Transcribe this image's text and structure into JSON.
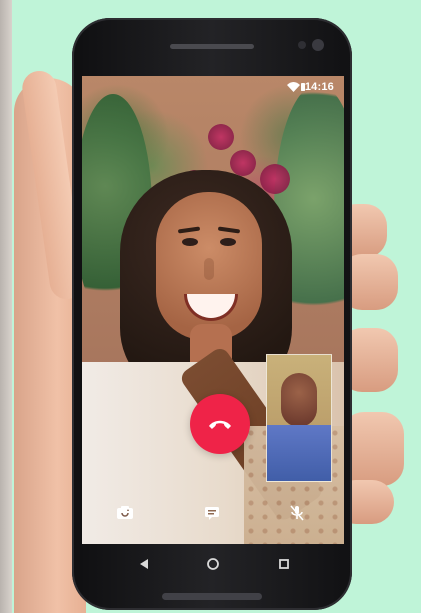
{
  "status_bar": {
    "time": "14:16",
    "icons": [
      "wifi-icon",
      "signal-icon",
      "battery-icon"
    ]
  },
  "call": {
    "end_call_icon": "phone-hangup-icon",
    "controls": [
      {
        "icon": "camera-switch-icon"
      },
      {
        "icon": "message-icon"
      },
      {
        "icon": "mute-mic-icon"
      }
    ],
    "colors": {
      "end_call": "#ef2348",
      "background": "#bff4d8"
    }
  },
  "navigation": {
    "back_icon": "back-triangle-icon",
    "home_icon": "home-circle-icon",
    "recent_icon": "recent-square-icon"
  }
}
